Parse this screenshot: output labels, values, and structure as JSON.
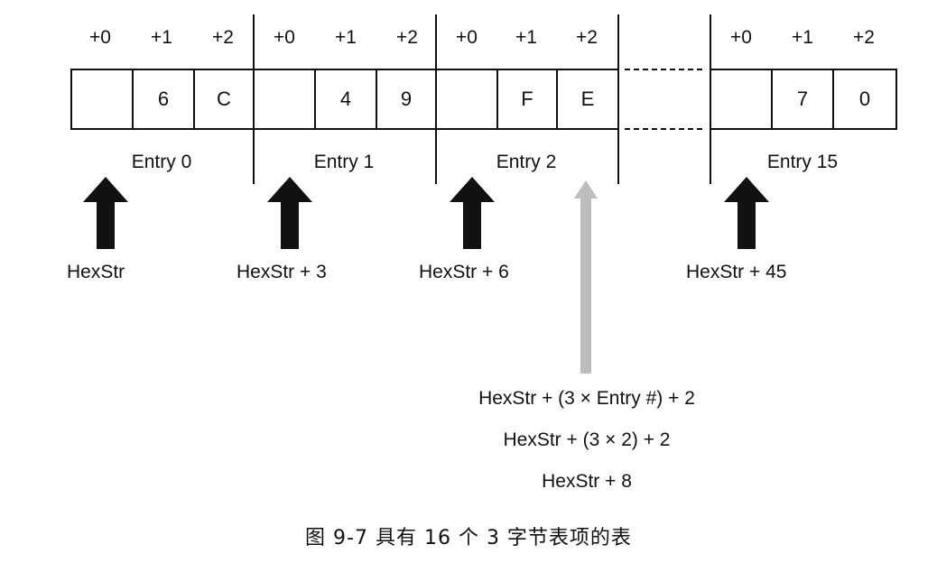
{
  "offsets": [
    "+0",
    "+1",
    "+2"
  ],
  "entries": [
    {
      "label": "Entry 0",
      "cells": [
        "",
        "6",
        "C"
      ],
      "pointer": "HexStr"
    },
    {
      "label": "Entry 1",
      "cells": [
        "",
        "4",
        "9"
      ],
      "pointer": "HexStr + 3"
    },
    {
      "label": "Entry 2",
      "cells": [
        "",
        "F",
        "E"
      ],
      "pointer": "HexStr + 6"
    },
    {
      "label": "Entry 15",
      "cells": [
        "",
        "7",
        "0"
      ],
      "pointer": "HexStr + 45"
    }
  ],
  "formula": [
    "HexStr + (3 × Entry #) + 2",
    "HexStr + (3 × 2) + 2",
    "HexStr + 8"
  ],
  "caption": "图 9-7   具有 16 个 3 字节表项的表",
  "colors": {
    "ink": "#111111",
    "highlight_arrow": "#bdbdbd"
  }
}
